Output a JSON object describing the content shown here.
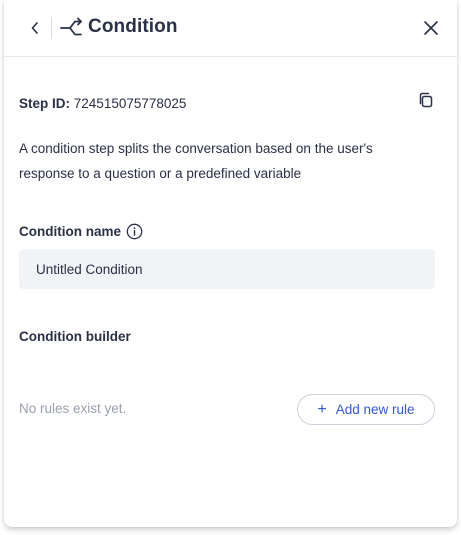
{
  "header": {
    "title": "Condition",
    "back_icon": "chevron-left-icon",
    "type_icon": "condition-split-icon",
    "close_icon": "close-icon"
  },
  "step": {
    "id_label": "Step ID:",
    "id_value": "724515075778025",
    "copy_icon": "copy-icon"
  },
  "description": "A condition step splits the conversation based on the user's response to a question or a predefined variable",
  "condition_name": {
    "label": "Condition name",
    "info_icon": "info-icon",
    "value": "Untitled Condition"
  },
  "builder": {
    "label": "Condition builder",
    "empty_text": "No rules exist yet.",
    "add_button_label": "Add new rule",
    "add_icon": "+"
  },
  "colors": {
    "accent": "#3557d6",
    "text": "#2a2f45",
    "muted": "#9aa0ad",
    "input_bg": "#f1f3f7"
  }
}
